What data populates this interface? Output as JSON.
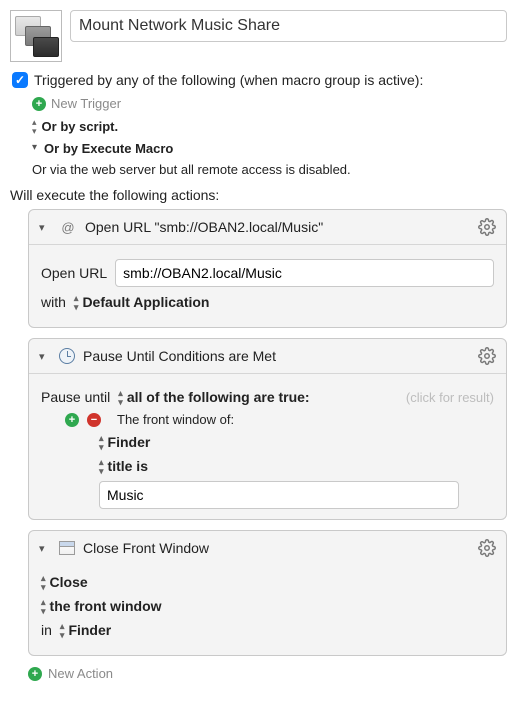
{
  "header": {
    "macro_name": "Mount Network Music Share"
  },
  "triggers": {
    "heading": "Triggered by any of the following (when macro group is active):",
    "new_trigger": "New Trigger",
    "by_script": "Or by script.",
    "by_execute_macro": "Or by Execute Macro",
    "web_server": "Or via the web server but all remote access is disabled."
  },
  "actions_heading": "Will execute the following actions:",
  "actions": {
    "open_url": {
      "title": "Open URL \"smb://OBAN2.local/Music\"",
      "label_open": "Open URL",
      "url_value": "smb://OBAN2.local/Music",
      "with_label": "with",
      "with_value": "Default Application"
    },
    "pause": {
      "title": "Pause Until Conditions are Met",
      "pause_until": "Pause until",
      "mode": "all of the following are true:",
      "result_hint": "(click for result)",
      "cond_label": "The front window of:",
      "app": "Finder",
      "op": "title is",
      "value": "Music"
    },
    "close": {
      "title": "Close Front Window",
      "verb": "Close",
      "target": "the front window",
      "in_label": "in",
      "app": "Finder"
    }
  },
  "new_action": "New Action"
}
